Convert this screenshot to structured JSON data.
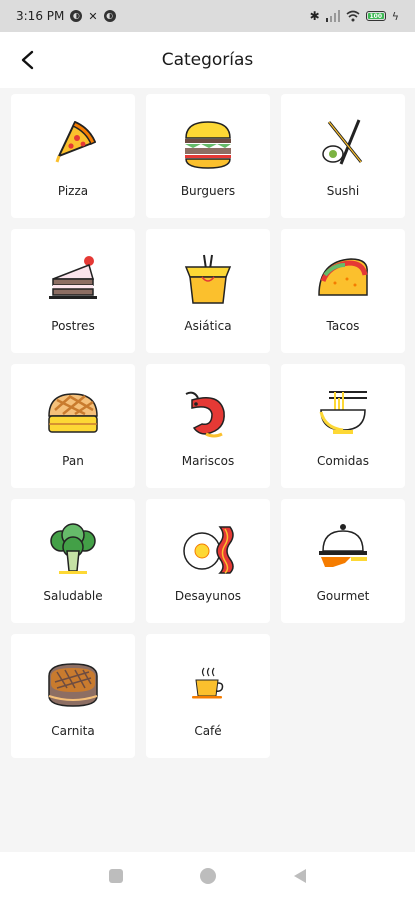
{
  "status_bar": {
    "time": "3:16 PM",
    "battery": "100"
  },
  "app_bar": {
    "title": "Categorías"
  },
  "categories": [
    {
      "label": "Pizza",
      "icon": "pizza-icon"
    },
    {
      "label": "Burguers",
      "icon": "burger-icon"
    },
    {
      "label": "Sushi",
      "icon": "sushi-icon"
    },
    {
      "label": "Postres",
      "icon": "cake-icon"
    },
    {
      "label": "Asiática",
      "icon": "takeout-box-icon"
    },
    {
      "label": "Tacos",
      "icon": "taco-icon"
    },
    {
      "label": "Pan",
      "icon": "bread-icon"
    },
    {
      "label": "Mariscos",
      "icon": "shrimp-icon"
    },
    {
      "label": "Comidas",
      "icon": "noodle-bowl-icon"
    },
    {
      "label": "Saludable",
      "icon": "broccoli-icon"
    },
    {
      "label": "Desayunos",
      "icon": "egg-bacon-icon"
    },
    {
      "label": "Gourmet",
      "icon": "cloche-icon"
    },
    {
      "label": "Carnita",
      "icon": "steak-icon"
    },
    {
      "label": "Café",
      "icon": "coffee-cup-icon"
    }
  ],
  "colors": {
    "background": "#f5f5f5",
    "card": "#ffffff",
    "accent_yellow": "#fdd835",
    "accent_red": "#e53935"
  }
}
